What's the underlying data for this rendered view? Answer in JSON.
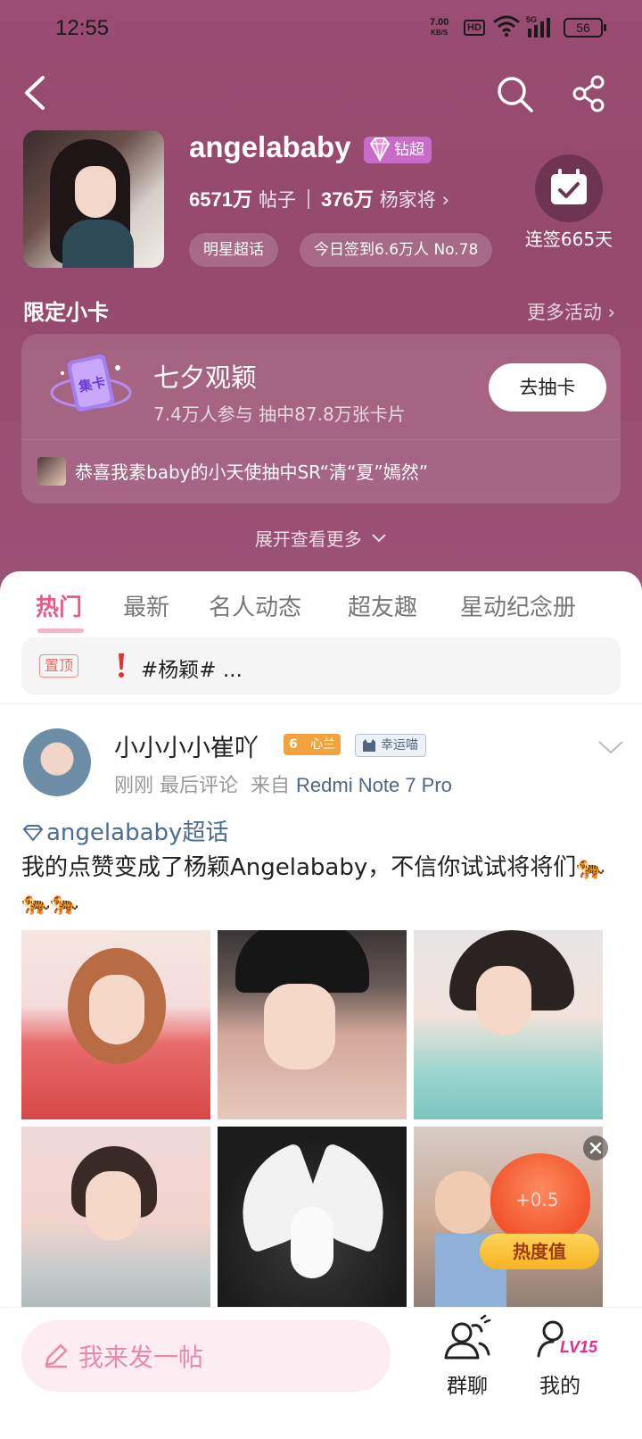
{
  "status_bar": {
    "time": "12:55",
    "net_rate_value": "7.00",
    "net_rate_unit": "KB/S",
    "hd_label": "HD",
    "signal_label": "5G",
    "battery": "56"
  },
  "nav": {
    "back_icon": "chevron-left-icon",
    "search_icon": "search-icon",
    "share_icon": "share-icon"
  },
  "profile": {
    "name": "angelababy",
    "badge": "钻超",
    "posts_count": "6571万",
    "posts_label": "帖子",
    "fans_count": "376万",
    "fans_label": "杨家将",
    "tag_1": "明星超话",
    "tag_2": "今日签到6.6万人 No.78",
    "checkin_label": "连签665天"
  },
  "limited_card": {
    "section_title": "限定小卡",
    "more_label": "更多活动",
    "card_badge": "集卡",
    "title": "七夕观颖",
    "subtitle": "7.4万人参与 抽中87.8万张卡片",
    "draw_button": "去抽卡",
    "ticker": "恭喜我素baby的小天使抽中SR“清“夏”嫣然”",
    "expand": "展开查看更多"
  },
  "tabs": [
    {
      "label": "热门",
      "active": true
    },
    {
      "label": "最新",
      "active": false
    },
    {
      "label": "名人动态",
      "active": false
    },
    {
      "label": "超友趣",
      "active": false
    },
    {
      "label": "星动纪念册",
      "active": false
    }
  ],
  "pinned": {
    "tag": "置顶",
    "text": "#杨颖# ..."
  },
  "post": {
    "author": "小小小小崔吖",
    "level": "6",
    "level_label": "心兰",
    "lucky_badge": "幸运喵",
    "time": "刚刚",
    "last_comment": "最后评论",
    "from_label": "来自",
    "device": "Redmi Note 7 Pro",
    "topic": "angelababy超话",
    "text": "我的点赞变成了杨颖Angelababy，不信你试试将将们🐅🐅🐅",
    "heat_plus": "+0.5",
    "heat_label": "热度值"
  },
  "bottom_bar": {
    "compose_placeholder": "我来发一帖",
    "group_label": "群聊",
    "mine_label": "我的",
    "level_badge": "LV15"
  },
  "colors": {
    "header_bg": "#9a4d72",
    "accent_pink": "#e95a8b",
    "link_blue": "#4b6d93"
  }
}
